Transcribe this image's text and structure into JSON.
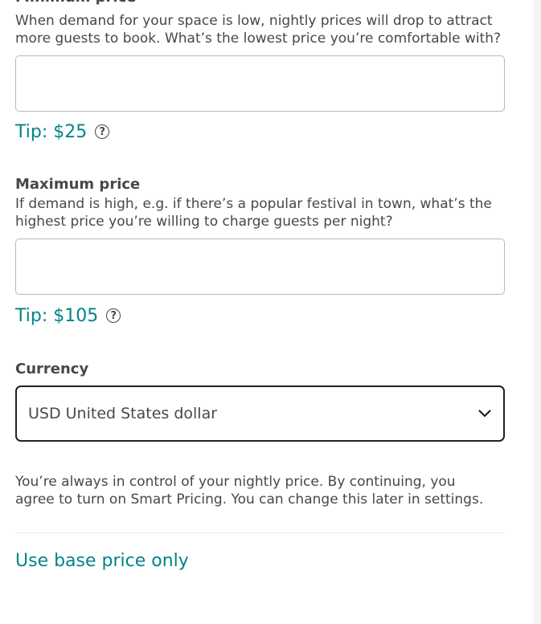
{
  "minimum_price": {
    "title": "Minimum price",
    "description": "When demand for your space is low, nightly prices will drop to attract more guests to book. What’s the lowest price you’re comfortable with?",
    "value": "",
    "tip": "Tip: $25",
    "help_icon": "question-circle-icon"
  },
  "maximum_price": {
    "title": "Maximum price",
    "description": "If demand is high, e.g. if there’s a popular festival in town, what’s the highest price you’re willing to charge guests per night?",
    "value": "",
    "tip": "Tip: $105",
    "help_icon": "question-circle-icon"
  },
  "currency": {
    "label": "Currency",
    "selected": "USD United States dollar",
    "icon": "chevron-down-icon"
  },
  "note": "You’re always in control of your nightly price. By continuing, you agree to turn on Smart Pricing. You can change this later in settings.",
  "base_price_link": "Use base price only",
  "colors": {
    "accent": "#008489",
    "text": "#484848",
    "select_border": "#222222",
    "input_border": "#b9b9b9"
  }
}
